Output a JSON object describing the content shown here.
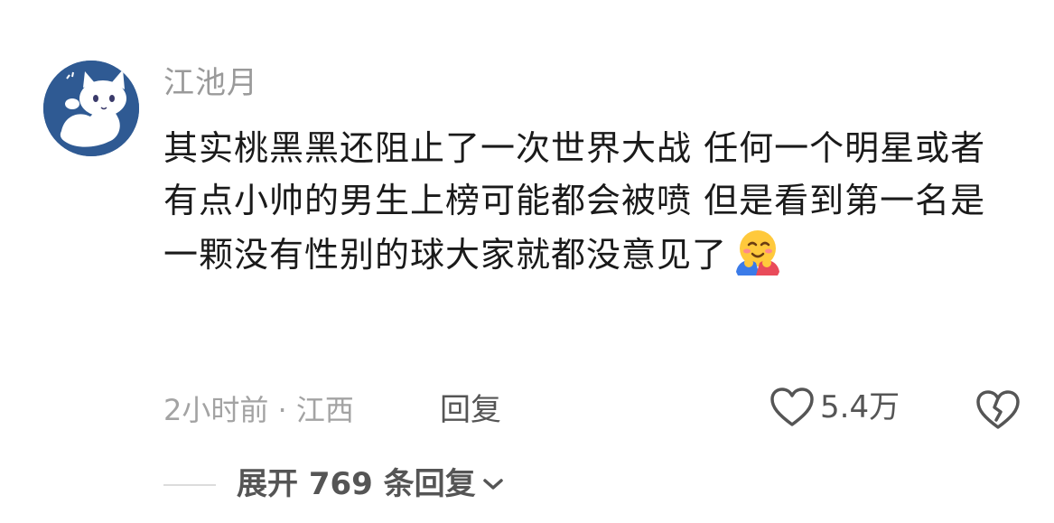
{
  "comment": {
    "username": "江池月",
    "text": "其实桃黑黑还阻止了一次世界大战 任何一个明星或者有点小帅的男生上榜可能都会被喷 但是看到第一名是一颗没有性别的球大家就都没意见了",
    "emoji": "hugging-face-emoji",
    "time": "2小时前",
    "separator": " · ",
    "location": "江西",
    "reply_label": "回复",
    "like_count": "5.4万",
    "expand_label": "展开 769 条回复"
  },
  "icons": {
    "avatar": "cat-avatar",
    "like": "heart-outline-icon",
    "dislike": "broken-heart-icon",
    "expand": "chevron-down-icon"
  },
  "colors": {
    "avatar_bg": "#2f5a93",
    "text": "#1a1a1a",
    "muted": "#a3a3a3",
    "action": "#555555"
  }
}
